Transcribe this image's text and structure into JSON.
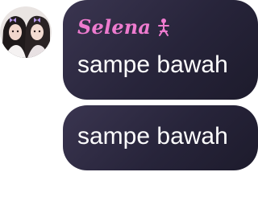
{
  "chat": {
    "messages": [
      {
        "sender": {
          "name": "Selena",
          "name_color": "#ee7bcf",
          "badge_icon": "pink-figure-icon"
        },
        "text": "sampe bawah"
      },
      {
        "text": "sampe bawah"
      }
    ],
    "bubble_color": "#27243a",
    "text_color": "#ffffff"
  }
}
